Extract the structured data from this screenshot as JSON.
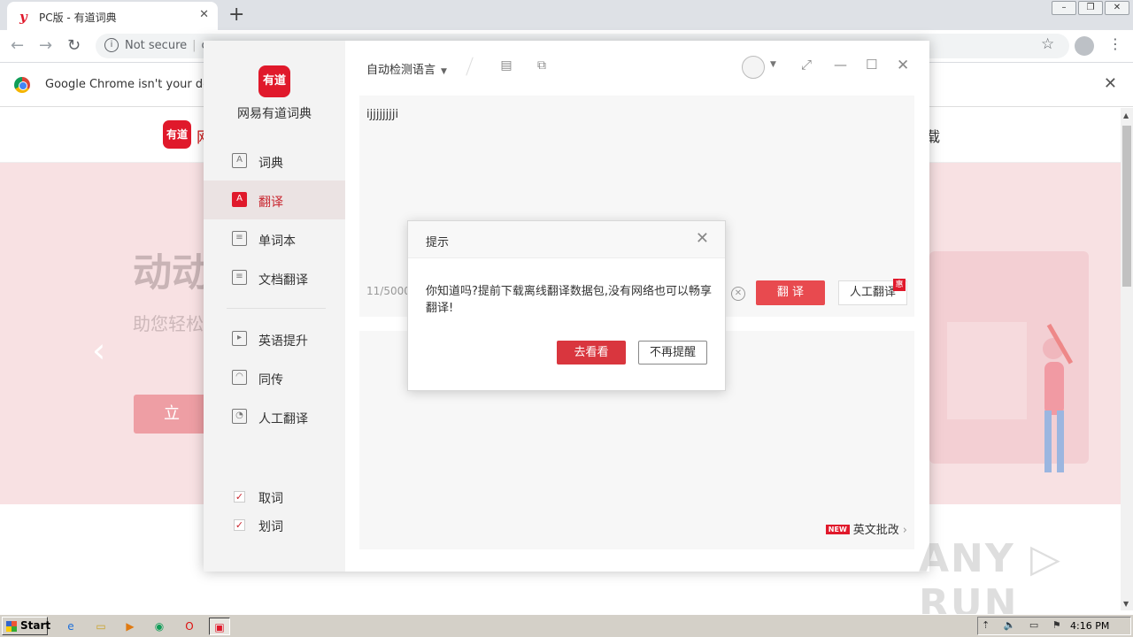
{
  "browser": {
    "tab_title": "PC版 - 有道词典",
    "tab_favicon": "y",
    "tab_close": "✕",
    "new_tab": "+",
    "address_security": "Not secure",
    "address_url": "c",
    "infobar_text": "Google Chrome isn't your default",
    "infobar_close": "✕"
  },
  "website": {
    "logo_text": "有道",
    "logo_trailing_char": "网",
    "nav_right_char": "载",
    "hero_title": "动动",
    "hero_subtitle": "助您轻松",
    "hero_button": "立",
    "arrow_left": "‹",
    "arrow_right": "›"
  },
  "app": {
    "logo_text": "有道",
    "name": "网易有道词典",
    "nav": [
      {
        "label": "词典",
        "icon": "A"
      },
      {
        "label": "翻译",
        "icon": "A",
        "active": true
      },
      {
        "label": "单词本",
        "icon": "≡"
      },
      {
        "label": "文档翻译",
        "icon": "≡"
      },
      {
        "label": "英语提升",
        "icon": "▸"
      },
      {
        "label": "同传",
        "icon": "◠"
      },
      {
        "label": "人工翻译",
        "icon": "◔"
      }
    ],
    "checks": [
      {
        "label": "取词",
        "mark": "✓",
        "checked": true
      },
      {
        "label": "划词",
        "mark": "✓",
        "checked": true
      }
    ],
    "lang_select": "自动检测语言",
    "input_text": "ijjjjjjjji",
    "char_count": "11/5000",
    "clear_icon": "✕",
    "translate_button": "翻 译",
    "human_translate_button": "人工翻译",
    "human_badge": "惠",
    "new_badge": "NEW",
    "essay_link": "英文批改",
    "essay_chevron": "›"
  },
  "dialog": {
    "title": "提示",
    "close": "✕",
    "message": "你知道吗?提前下载离线翻译数据包,没有网络也可以畅享翻译!",
    "primary_button": "去看看",
    "secondary_button": "不再提醒"
  },
  "watermark": "ANY ▷ RUN",
  "taskbar": {
    "start_label": "Start",
    "clock": "4:16 PM"
  },
  "colors": {
    "accent_red": "#e0192b",
    "translate_button": "#e84a4f",
    "dialog_primary": "#d9363e",
    "hero_background": "#f8e1e3"
  }
}
